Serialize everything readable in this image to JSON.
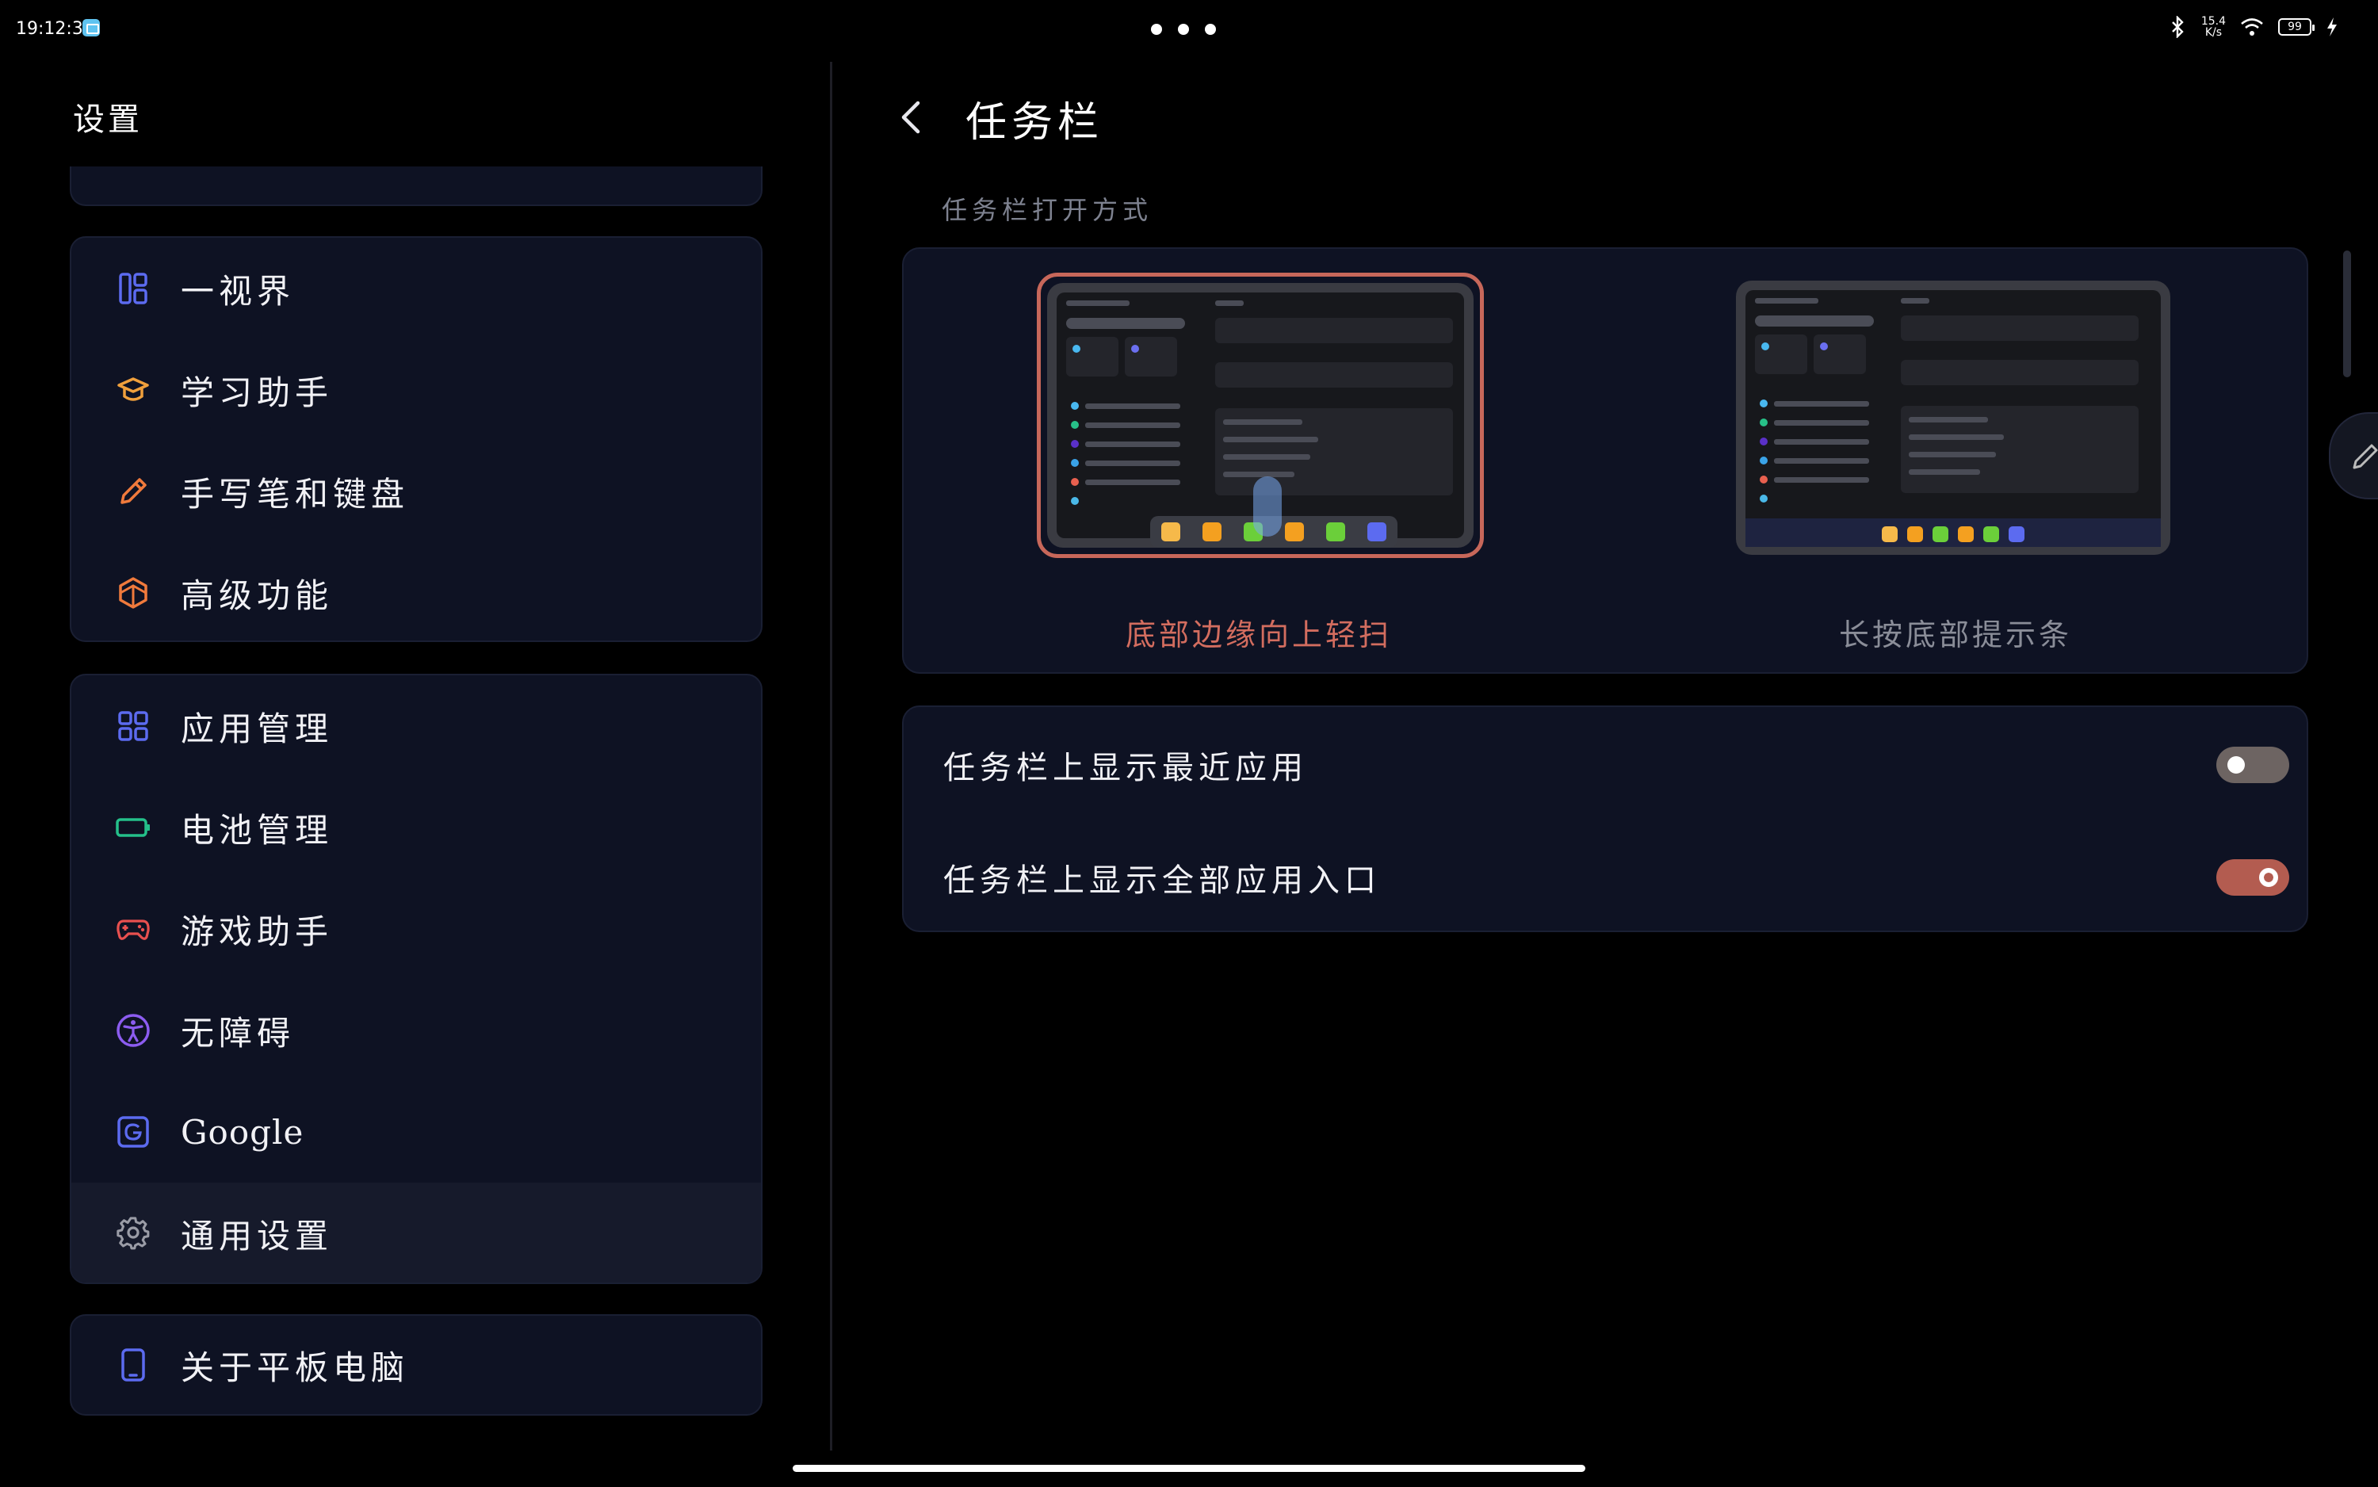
{
  "status_bar": {
    "time": "19:12:36",
    "page_dots": 3,
    "net_speed_top": "15.4",
    "net_speed_bottom": "K/s",
    "battery": "99"
  },
  "left": {
    "title": "设置",
    "group1": [
      {
        "label": "一视界",
        "icon": "multi-window-icon",
        "color": "#5c6bf0"
      },
      {
        "label": "学习助手",
        "icon": "graduation-cap-icon",
        "color": "#f0a03c"
      },
      {
        "label": "手写笔和键盘",
        "icon": "pencil-icon",
        "color": "#f07a3c"
      },
      {
        "label": "高级功能",
        "icon": "cube-icon",
        "color": "#f07a3c"
      }
    ],
    "group2": [
      {
        "label": "应用管理",
        "icon": "grid-icon",
        "color": "#5c6bf0"
      },
      {
        "label": "电池管理",
        "icon": "battery-icon",
        "color": "#24c08a"
      },
      {
        "label": "游戏助手",
        "icon": "gamepad-icon",
        "color": "#e8504f"
      },
      {
        "label": "无障碍",
        "icon": "accessibility-icon",
        "color": "#8c5cf0"
      },
      {
        "label": "Google",
        "icon": "google-icon",
        "color": "#5c6bf0"
      },
      {
        "label": "通用设置",
        "icon": "gear-icon",
        "color": "#9a9ca6"
      }
    ],
    "group3": [
      {
        "label": "关于平板电脑",
        "icon": "tablet-icon",
        "color": "#5c6bf0"
      }
    ]
  },
  "right": {
    "title": "任务栏",
    "section_label": "任务栏打开方式",
    "modes": [
      {
        "label": "底部边缘向上轻扫",
        "selected": true
      },
      {
        "label": "长按底部提示条",
        "selected": false
      }
    ],
    "toggles": [
      {
        "label": "任务栏上显示最近应用",
        "on": false
      },
      {
        "label": "任务栏上显示全部应用入口",
        "on": true
      }
    ],
    "accent_color": "#d36d5f"
  }
}
